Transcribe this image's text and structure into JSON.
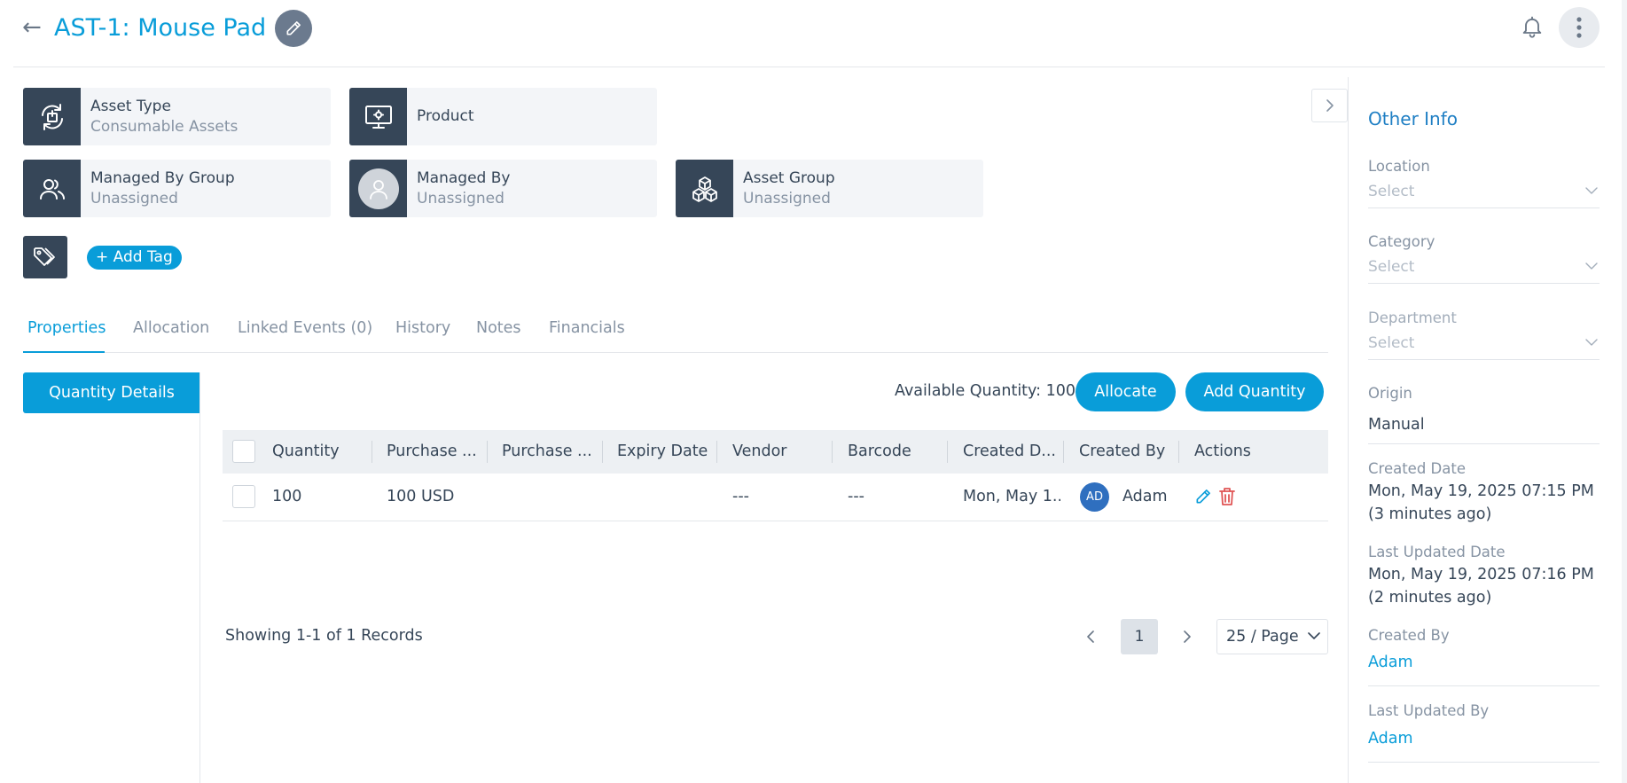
{
  "header": {
    "back_icon": "arrow-left-icon",
    "title": "AST-1: Mouse Pad",
    "edit_icon": "pencil-icon",
    "bell_icon": "bell-icon",
    "more_icon": "kebab-vertical-icon"
  },
  "cards": {
    "asset_type": {
      "label": "Asset Type",
      "value": "Consumable Assets",
      "icon": "asset-cycle-icon"
    },
    "product": {
      "label": "Product",
      "icon": "monitor-gear-icon"
    },
    "managed_by_group": {
      "label": "Managed By Group",
      "value": "Unassigned",
      "icon": "users-icon"
    },
    "managed_by": {
      "label": "Managed By",
      "value": "Unassigned",
      "icon": "user-avatar-icon"
    },
    "asset_group": {
      "label": "Asset Group",
      "value": "Unassigned",
      "icon": "cubes-icon"
    }
  },
  "tags": {
    "icon": "tags-icon",
    "add_tag_label": "+ Add Tag"
  },
  "tabs": [
    {
      "label": "Properties",
      "active": true
    },
    {
      "label": "Allocation"
    },
    {
      "label": "Linked Events (0)"
    },
    {
      "label": "History"
    },
    {
      "label": "Notes"
    },
    {
      "label": "Financials"
    }
  ],
  "subnav": {
    "quantity_details": "Quantity Details"
  },
  "toolbar": {
    "available_quantity": "Available Quantity: 100",
    "allocate": "Allocate",
    "add_quantity": "Add Quantity"
  },
  "table": {
    "columns": [
      "Quantity",
      "Purchase ...",
      "Purchase ...",
      "Expiry Date",
      "Vendor",
      "Barcode",
      "Created D...",
      "Created By",
      "Actions"
    ],
    "rows": [
      {
        "quantity": "100",
        "purchase_cost": "100  USD",
        "purchase_date": "",
        "expiry_date": "",
        "vendor": "---",
        "barcode": "---",
        "created_date": "Mon, May 1...",
        "created_by_initials": "AD",
        "created_by": "Adam",
        "edit_icon": "pencil-icon",
        "delete_icon": "trash-icon"
      }
    ]
  },
  "pagination": {
    "showing": "Showing 1-1 of 1 Records",
    "current_page": "1",
    "page_size": "25 / Page"
  },
  "side_panel": {
    "toggle_icon": "chevron-right-icon",
    "title": "Other Info",
    "location": {
      "label": "Location",
      "placeholder": "Select"
    },
    "category": {
      "label": "Category",
      "placeholder": "Select"
    },
    "department": {
      "label": "Department",
      "placeholder": "Select"
    },
    "origin": {
      "label": "Origin",
      "value": "Manual"
    },
    "created_date": {
      "label": "Created Date",
      "value": "Mon, May 19, 2025 07:15 PM",
      "relative": "(3 minutes ago)"
    },
    "last_updated_date": {
      "label": "Last Updated Date",
      "value": "Mon, May 19, 2025 07:16 PM",
      "relative": "(2 minutes ago)"
    },
    "created_by": {
      "label": "Created By",
      "value": "Adam"
    },
    "last_updated_by": {
      "label": "Last Updated By",
      "value": "Adam"
    }
  },
  "colors": {
    "accent": "#099dd9",
    "dark_tile": "#364658",
    "card_bg": "#f3f5f8",
    "delete": "#e05555"
  }
}
